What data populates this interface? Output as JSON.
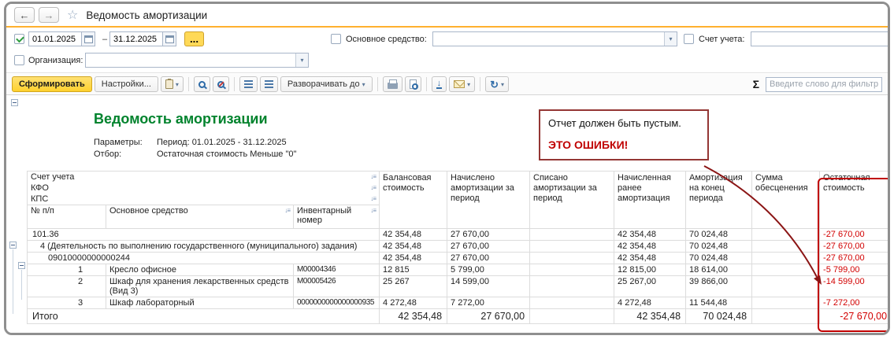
{
  "icons": {
    "back": "←",
    "forward": "→",
    "star": "☆",
    "dropdown": "▾",
    "refresh": "↻",
    "save_arrow": "↓",
    "sort": "↓≡"
  },
  "titlebar": {
    "title": "Ведомость амортизации"
  },
  "filters": {
    "period_from": "01.01.2025",
    "period_to": "31.12.2025",
    "range_dash": "–",
    "period_more": "...",
    "asset_label": "Основное средство:",
    "account_label": "Счет учета:",
    "org_label": "Организация:"
  },
  "toolbar": {
    "generate": "Сформировать",
    "settings": "Настройки...",
    "expand_to": "Разворачивать до",
    "sum_symbol": "Σ",
    "filter_placeholder": "Введите слово для фильтра (название то..."
  },
  "report": {
    "title": "Ведомость амортизации",
    "params_label": "Параметры:",
    "params_value": "Период: 01.01.2025 - 31.12.2025",
    "filter_label": "Отбор:",
    "filter_value": "Остаточная стоимость Меньше \"0\"",
    "annotation": {
      "line1": "Отчет должен быть пустым.",
      "line2": "ЭТО ОШИБКИ!"
    },
    "header": {
      "account": "Счет учета",
      "kfo": "КФО",
      "kps": "КПС",
      "num": "№ п/п",
      "asset": "Основное средство",
      "inventory": "Инвентарный номер",
      "cols": [
        "Балансовая стоимость",
        "Начислено амортизации за период",
        "Списано амортизации за период",
        "Начисленная ранее амортизация",
        "Амортизация на конец периода",
        "Сумма обесценения",
        "Остаточная стоимость"
      ]
    },
    "rows": [
      {
        "kind": "group",
        "level": 0,
        "label": "101.36",
        "values": [
          "42 354,48",
          "27 670,00",
          "",
          "42 354,48",
          "70 024,48",
          "",
          "-27 670,00"
        ]
      },
      {
        "kind": "group",
        "level": 1,
        "label": "4 (Деятельность по выполнению государственного (муниципального) задания)",
        "values": [
          "42 354,48",
          "27 670,00",
          "",
          "42 354,48",
          "70 024,48",
          "",
          "-27 670,00"
        ]
      },
      {
        "kind": "group",
        "level": 2,
        "label": "09010000000000244",
        "values": [
          "42 354,48",
          "27 670,00",
          "",
          "42 354,48",
          "70 024,48",
          "",
          "-27 670,00"
        ]
      },
      {
        "kind": "item",
        "num": "1",
        "name": "Кресло офисное",
        "inv": "М00004346",
        "values": [
          "12 815",
          "5 799,00",
          "",
          "12 815,00",
          "18 614,00",
          "",
          "-5 799,00"
        ]
      },
      {
        "kind": "item",
        "num": "2",
        "name": "Шкаф для хранения лекарственных средств (Вид 3)",
        "inv": "М00005426",
        "values": [
          "25 267",
          "14 599,00",
          "",
          "25 267,00",
          "39 866,00",
          "",
          "-14 599,00"
        ]
      },
      {
        "kind": "item",
        "num": "3",
        "name": "Шкаф лабораторный",
        "inv": "0000000000000000935",
        "values": [
          "4 272,48",
          "7 272,00",
          "",
          "4 272,48",
          "11 544,48",
          "",
          "-7 272,00"
        ]
      }
    ],
    "total": {
      "label": "Итого",
      "values": [
        "42 354,48",
        "27 670,00",
        "",
        "42 354,48",
        "70 024,48",
        "",
        "-27 670,00"
      ]
    }
  }
}
